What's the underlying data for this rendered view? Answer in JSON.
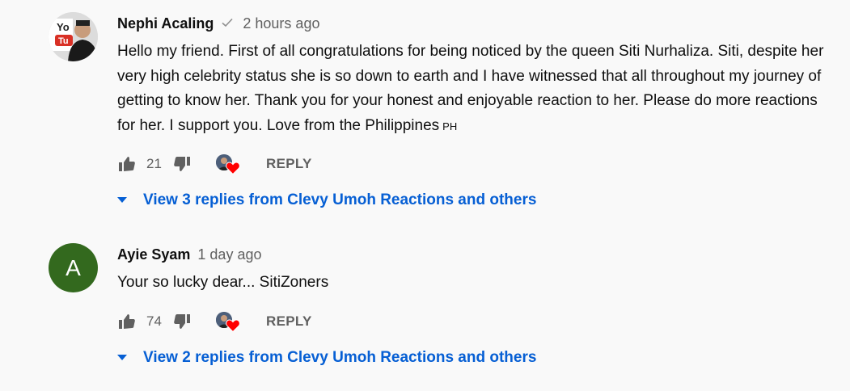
{
  "comments": [
    {
      "author": "Nephi Acaling",
      "verified_icon": "check-icon",
      "time": "2 hours ago",
      "avatar_type": "photo",
      "text": "Hello my friend. First of all congratulations for being noticed by the queen Siti Nurhaliza. Siti, despite her very high celebrity status she is so down to earth and I have witnessed that all throughout my journey of getting to know her. Thank you for your honest and enjoyable reaction to her. Please do more reactions for her. I support you. Love from the Philippines",
      "flag_text": "PH",
      "likes": "21",
      "reply_label": "REPLY",
      "replies_label": "View 3 replies from Clevy Umoh Reactions and others"
    },
    {
      "author": "Ayie Syam",
      "time": "1 day ago",
      "avatar_letter": "A",
      "avatar_color": "#33691e",
      "text": "Your so lucky dear... SitiZoners",
      "likes": "74",
      "reply_label": "REPLY",
      "replies_label": "View 2 replies from Clevy Umoh Reactions and others"
    }
  ],
  "colors": {
    "link": "#065fd4",
    "secondary_text": "#606060",
    "heart": "#ff0000"
  }
}
